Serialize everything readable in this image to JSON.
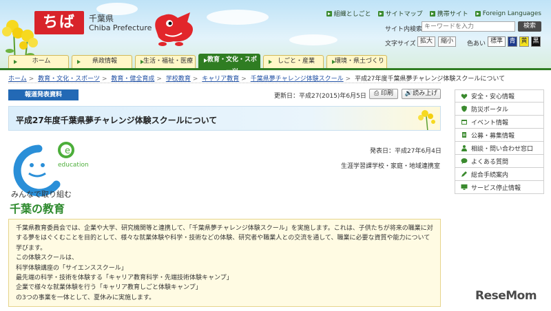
{
  "header": {
    "logo_text": "ちば",
    "pref_jp": "千葉県",
    "pref_en": "Chiba Prefecture",
    "top_links": [
      "組織としごと",
      "サイトマップ",
      "携帯サイト",
      "Foreign Languages"
    ],
    "search_label": "サイト内検索",
    "search_placeholder": "キーワードを入力",
    "search_button": "検索",
    "font_size_label": "文字サイズ",
    "font_enlarge": "拡大",
    "font_shrink": "縮小",
    "color_label": "色あい",
    "color_standard": "標準",
    "color_blue": "青",
    "color_yellow": "黄",
    "color_black": "黒"
  },
  "nav": {
    "tabs": [
      "ホーム",
      "県政情報",
      "生活・福祉・医療",
      "教育・文化・スポーツ",
      "しごと・産業",
      "環境・県土づくり"
    ],
    "active_index": 3
  },
  "breadcrumb": {
    "items": [
      "ホーム",
      "教育・文化・スポーツ",
      "教育・健全育成",
      "学校教育",
      "キャリア教育",
      "千葉県夢チャレンジ体験スクール"
    ],
    "current": "平成27年度千葉県夢チャレンジ体験スクールについて",
    "separator": ">"
  },
  "main": {
    "badge": "報道発表資料",
    "updated": "更新日：平成27(2015)年6月5日",
    "print": "印刷",
    "read_aloud": "読み上げ",
    "title": "平成27年度千葉県夢チャレンジ体験スクールについて",
    "logo_text": "education",
    "logo_sub": "みんなで取り組む",
    "logo_main": "千葉の教育",
    "pub_date": "発表日：平成27年6月4日",
    "department": "生涯学習課学校・家庭・地域連携室",
    "body": [
      "千葉県教育委員会では、企業や大学、研究機関等と連携して、「千葉県夢チャレンジ体験スクール」を実施します。これは、子供たちが将来の職業に対",
      "する夢をはぐくむことを目的として、様々な就業体験や科学・技術などの体験、研究者や職業人との交流を通して、職業に必要な資質や能力について",
      "学びます。",
      "この体験スクールは、",
      "科学体験講座の「サイエンススクール」",
      "最先端の科学・技術を体験する「キャリア教育科学・先端技術体験キャンプ」",
      "企業で様々な就業体験を行う「キャリア教育しごと体験キャンプ」",
      "の3つの事業を一体として、夏休みに実施します。"
    ]
  },
  "sidebar": {
    "items": [
      "安全・安心情報",
      "防災ポータル",
      "イベント情報",
      "公募・募集情報",
      "相談・問い合わせ窓口",
      "よくある質問",
      "総合手続案内",
      "サービス停止情報"
    ]
  },
  "watermark": "ReseMom",
  "colors": {
    "accent_green": "#2f7d22",
    "brand_red": "#d8232a",
    "badge_blue": "#2369b5",
    "link_blue": "#2453a5"
  }
}
